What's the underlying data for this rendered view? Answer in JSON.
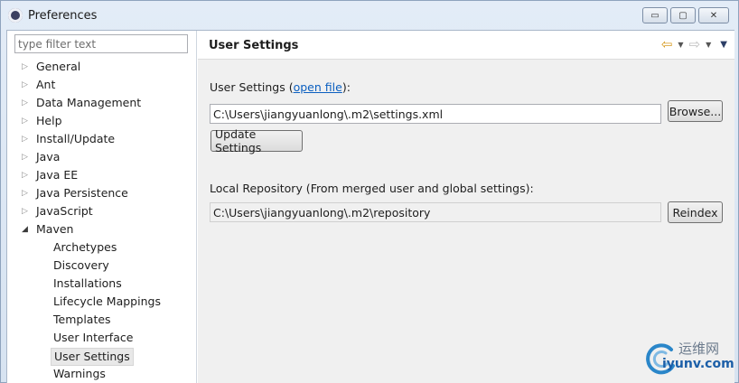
{
  "window": {
    "title": "Preferences",
    "controls": {
      "minimize": "▭",
      "maximize": "▢",
      "close": "✕"
    }
  },
  "sidebar": {
    "filter_placeholder": "type filter text",
    "items": [
      {
        "label": "General",
        "state": "collapsed"
      },
      {
        "label": "Ant",
        "state": "collapsed"
      },
      {
        "label": "Data Management",
        "state": "collapsed"
      },
      {
        "label": "Help",
        "state": "collapsed"
      },
      {
        "label": "Install/Update",
        "state": "collapsed"
      },
      {
        "label": "Java",
        "state": "collapsed"
      },
      {
        "label": "Java EE",
        "state": "collapsed"
      },
      {
        "label": "Java Persistence",
        "state": "collapsed"
      },
      {
        "label": "JavaScript",
        "state": "collapsed"
      },
      {
        "label": "Maven",
        "state": "expanded"
      }
    ],
    "maven_children": [
      "Archetypes",
      "Discovery",
      "Installations",
      "Lifecycle Mappings",
      "Templates",
      "User Interface",
      "User Settings",
      "Warnings"
    ],
    "selected": "User Settings"
  },
  "main": {
    "title": "User Settings",
    "user_settings_label": "User Settings (",
    "open_file_link": "open file",
    "user_settings_label_end": "):",
    "settings_path": "C:\\Users\\jiangyuanlong\\.m2\\settings.xml",
    "browse_label": "Browse...",
    "update_label": "Update Settings",
    "local_repo_label": "Local Repository (From merged user and global settings):",
    "repo_path": "C:\\Users\\jiangyuanlong\\.m2\\repository",
    "reindex_label": "Reindex"
  },
  "watermark": {
    "cn": "运维网",
    "en": "iyunv.com"
  },
  "colors": {
    "link": "#0b5fc0",
    "back_arrow": "#d69a1f",
    "watermark_blue": "#1c5fa8"
  }
}
